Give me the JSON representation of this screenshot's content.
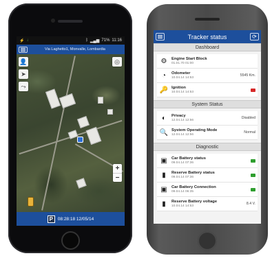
{
  "colors": {
    "brand_blue": "#1d4f9c",
    "status_red": "#d62828",
    "status_green": "#2e9e2e"
  },
  "phone_map": {
    "system_bar": {
      "battery": "71%",
      "time": "11:16"
    },
    "header": {
      "address": "Via Laghetto1, Monvalle, Lombardia"
    },
    "map_controls": {
      "person_icon": "person-icon",
      "navigate_icon": "navigate-arrow-icon",
      "route_icon": "route-icon",
      "locate_icon": "locate-icon",
      "zoom_in": "+",
      "zoom_out": "−"
    },
    "footer": {
      "parking_label": "P",
      "timestamp": "08:28:18 12/05/14"
    }
  },
  "phone_status": {
    "header": {
      "title": "Tracker status"
    },
    "sections": [
      {
        "title": "Dashboard",
        "items": [
          {
            "name": "Engine Start Block",
            "date": "01.01.70 01:00",
            "value": "",
            "status": "",
            "icon": "engine-icon"
          },
          {
            "name": "Odometer",
            "date": "10.04.14 14:53",
            "value": "5545 Km.",
            "status": "",
            "icon": "gauge-icon"
          },
          {
            "name": "Ignition",
            "date": "10.04.14 14:53",
            "value": "",
            "status": "red",
            "icon": "key-icon"
          }
        ]
      },
      {
        "title": "System Status",
        "items": [
          {
            "name": "Privacy",
            "date": "12.04.14 12:56",
            "value": "Disabled",
            "status": "",
            "icon": "privacy-icon"
          },
          {
            "name": "System Operating Mode",
            "date": "12.04.14 12:56",
            "value": "Normal",
            "status": "",
            "icon": "search-icon"
          }
        ]
      },
      {
        "title": "Diagnostic",
        "items": [
          {
            "name": "Car Battery status",
            "date": "09.04.14 07:36",
            "value": "",
            "status": "green",
            "icon": "car-battery-icon"
          },
          {
            "name": "Reserve Battery status",
            "date": "09.04.14 07:36",
            "value": "",
            "status": "green",
            "icon": "battery-icon"
          },
          {
            "name": "Car Battery Connection",
            "date": "09.04.14 06:35",
            "value": "",
            "status": "green",
            "icon": "car-battery-icon"
          },
          {
            "name": "Reserve Battery voltage",
            "date": "10.04.14 14:53",
            "value": "8.4 V.",
            "status": "",
            "icon": "battery-icon"
          }
        ]
      }
    ]
  }
}
